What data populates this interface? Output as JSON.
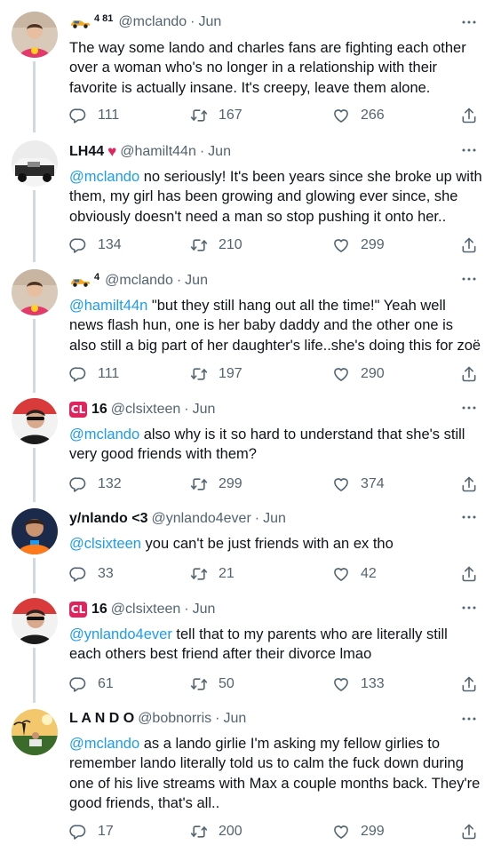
{
  "tweets": [
    {
      "display_name": "4 81",
      "handle": "@mclando",
      "time": "Jun",
      "mention": "",
      "text": "The way some lando and charles fans are fighting each other over a woman who's no longer in a relationship with their favorite is actually insane. It's creepy, leave them alone.",
      "replies": "111",
      "retweets": "167",
      "likes": "266"
    },
    {
      "display_name": "LH44",
      "handle": "@hamilt44n",
      "time": "Jun",
      "mention": "@mclando",
      "text": " no seriously! It's been years since she broke up with them, my girl has been growing and glowing ever since, she obviously doesn't need a man so stop pushing it onto her..",
      "replies": "134",
      "retweets": "210",
      "likes": "299"
    },
    {
      "display_name": "4",
      "handle": "@mclando",
      "time": "Jun",
      "mention": "@hamilt44n",
      "text": " \"but they still hang out all the time!\" Yeah well news flash hun, one is her baby daddy and the other one is also still a big part of her daughter's life..she's doing this for zoë",
      "replies": "111",
      "retweets": "197",
      "likes": "290"
    },
    {
      "display_name": "16",
      "handle": "@clsixteen",
      "time": "Jun",
      "mention": "@mclando",
      "text": " also why is it so hard to understand that she's still very good friends with them?",
      "replies": "132",
      "retweets": "299",
      "likes": "374"
    },
    {
      "display_name": "y/nlando <3",
      "handle": "@ynlando4ever",
      "time": "Jun",
      "mention": "@clsixteen",
      "text": " you can't be just friends with an ex tho",
      "replies": "33",
      "retweets": "21",
      "likes": "42"
    },
    {
      "display_name": "16",
      "handle": "@clsixteen",
      "time": "Jun",
      "mention": "@ynlando4ever",
      "text": " tell that to my parents who are literally still each others best friend after their divorce lmao",
      "replies": "61",
      "retweets": "50",
      "likes": "133"
    },
    {
      "display_name": "L A N D O",
      "handle": "@bobnorris",
      "time": "Jun",
      "mention": "@mclando",
      "text": " as a lando girlie I'm asking my fellow girlies to remember lando literally told us to calm the fuck down during one of his live streams with Max a couple months back. They're good friends, that's all..",
      "replies": "17",
      "retweets": "200",
      "likes": "299"
    }
  ],
  "badges": {
    "cl": "CL"
  },
  "colors": {
    "accent": "#1d9bf0",
    "muted": "#536471",
    "text": "#0f1419",
    "line": "#cfd9de",
    "heart": "#e0245e"
  },
  "icons": [
    "car-emoji-icon",
    "red-heart-icon",
    "more-options-icon",
    "reply-icon",
    "retweet-icon",
    "like-icon",
    "share-icon"
  ]
}
